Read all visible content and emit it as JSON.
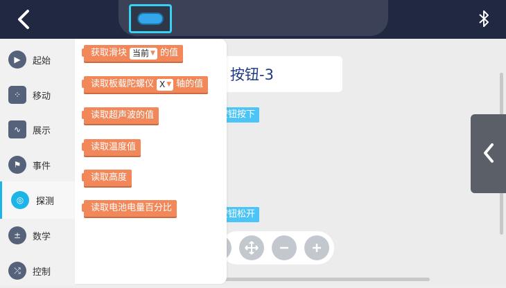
{
  "topbar": {
    "back_icon": "chevron-left-icon",
    "bluetooth_icon": "bluetooth-icon"
  },
  "sidebar": {
    "items": [
      {
        "label": "起始",
        "icon": "play-icon"
      },
      {
        "label": "移动",
        "icon": "dice-icon"
      },
      {
        "label": "展示",
        "icon": "wave-icon"
      },
      {
        "label": "事件",
        "icon": "flag-icon"
      },
      {
        "label": "探测",
        "icon": "radar-icon",
        "active": true
      },
      {
        "label": "数学",
        "icon": "math-icon"
      },
      {
        "label": "控制",
        "icon": "shuffle-icon"
      }
    ]
  },
  "flyout": {
    "blocks": [
      {
        "pre": "获取滑块",
        "dropdown": "当前",
        "post": "的值"
      },
      {
        "pre": "读取板载陀螺仪",
        "dropdown": "X",
        "post": "轴的值"
      },
      {
        "pre": "读取超声波的值"
      },
      {
        "pre": "读取温度值"
      },
      {
        "pre": "读取高度"
      },
      {
        "pre": "读取电池电量百分比"
      }
    ]
  },
  "workspace": {
    "card_title": "按钮-3",
    "event_press": "按钮按下",
    "event_release": "按钮松开"
  },
  "colors": {
    "topbar": "#202842",
    "sensor_block": "#f2875a",
    "event_block": "#4cc4f6",
    "accent": "#1fb4e8"
  }
}
